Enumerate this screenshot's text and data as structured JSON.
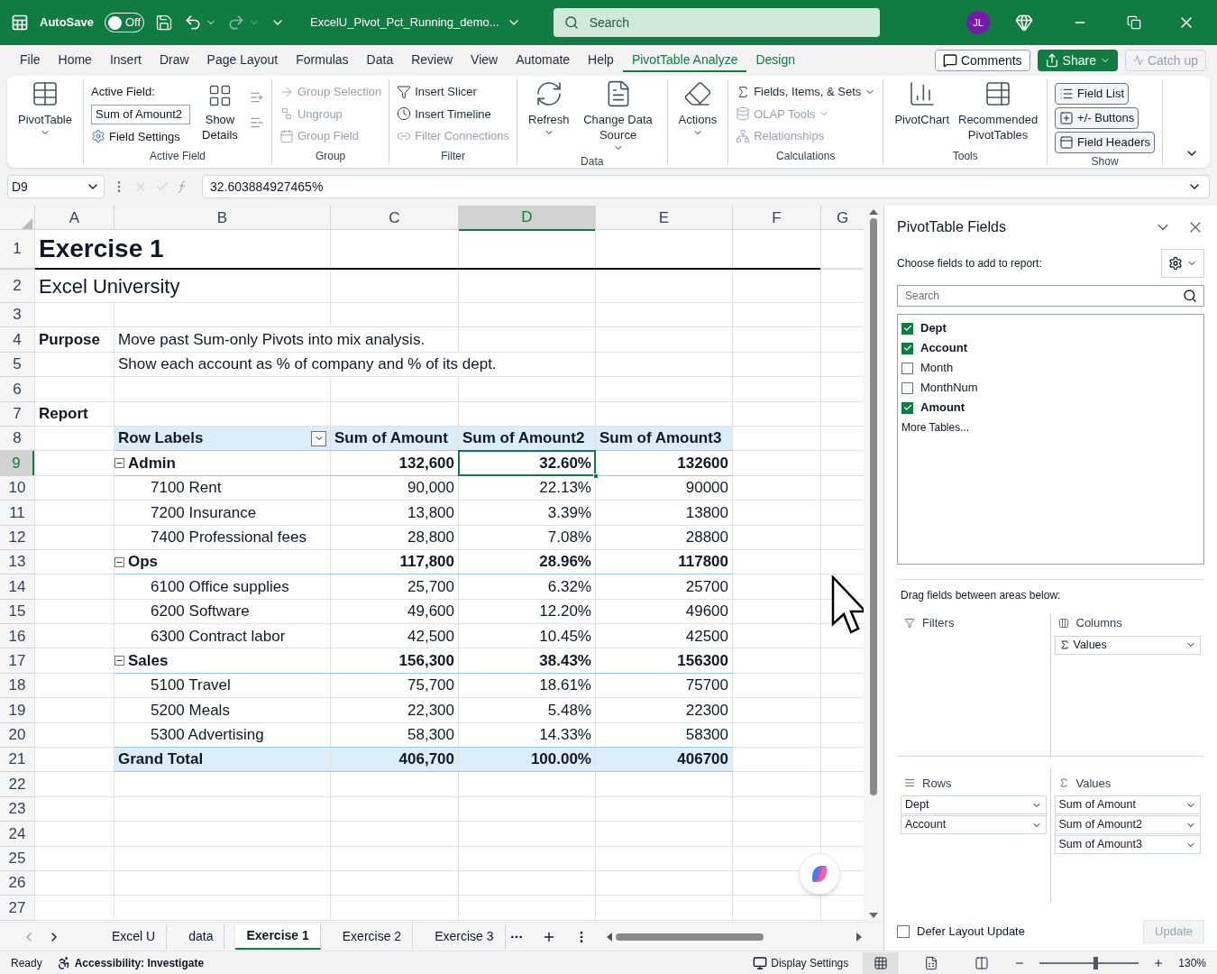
{
  "title_bar": {
    "autosave": {
      "label": "AutoSave",
      "state": "Off",
      "on": false
    },
    "file_name": "ExcelU_Pivot_Pct_Running_demo...",
    "search": {
      "placeholder": "Search"
    },
    "avatar": "JL"
  },
  "menu_tabs": [
    {
      "label": "File",
      "selected": false,
      "kind": "normal"
    },
    {
      "label": "Home",
      "selected": false,
      "kind": "normal"
    },
    {
      "label": "Insert",
      "selected": false,
      "kind": "normal"
    },
    {
      "label": "Draw",
      "selected": false,
      "kind": "normal"
    },
    {
      "label": "Page Layout",
      "selected": false,
      "kind": "normal"
    },
    {
      "label": "Formulas",
      "selected": false,
      "kind": "normal"
    },
    {
      "label": "Data",
      "selected": false,
      "kind": "normal"
    },
    {
      "label": "Review",
      "selected": false,
      "kind": "normal"
    },
    {
      "label": "View",
      "selected": false,
      "kind": "normal"
    },
    {
      "label": "Automate",
      "selected": false,
      "kind": "normal"
    },
    {
      "label": "Help",
      "selected": false,
      "kind": "normal"
    },
    {
      "label": "PivotTable Analyze",
      "selected": true,
      "kind": "contextual"
    },
    {
      "label": "Design",
      "selected": false,
      "kind": "contextual"
    }
  ],
  "menu_actions": {
    "comments": "Comments",
    "share": "Share",
    "catch_up": {
      "label": "Catch up",
      "disabled": true
    }
  },
  "ribbon": {
    "groups": [
      {
        "kind": "large",
        "items": [
          {
            "label": "PivotTable",
            "caret": true,
            "disabled": false
          }
        ]
      },
      {
        "kind": "active_field",
        "label": "Active Field",
        "field_label": "Active Field:",
        "field_value": "Sum of Amount2",
        "settings": "Field Settings",
        "details": "Show Details"
      },
      {
        "kind": "small",
        "label": "Group",
        "items": [
          {
            "label": "Group Selection",
            "caret": false,
            "disabled": true
          },
          {
            "label": "Ungroup",
            "caret": false,
            "disabled": true
          },
          {
            "label": "Group Field",
            "caret": false,
            "disabled": true
          }
        ]
      },
      {
        "kind": "small",
        "label": "Filter",
        "items": [
          {
            "label": "Insert Slicer",
            "caret": false,
            "disabled": false
          },
          {
            "label": "Insert Timeline",
            "caret": false,
            "disabled": false
          },
          {
            "label": "Filter Connections",
            "caret": false,
            "disabled": true
          }
        ]
      },
      {
        "kind": "large",
        "label": "Data",
        "items": [
          {
            "label": "Refresh",
            "caret": true,
            "disabled": false
          },
          {
            "label": "Change Data Source",
            "caret": true,
            "disabled": false
          }
        ]
      },
      {
        "kind": "large",
        "items": [
          {
            "label": "Actions",
            "caret": true,
            "disabled": false
          }
        ]
      },
      {
        "kind": "small",
        "label": "Calculations",
        "items": [
          {
            "label": "Fields, Items, & Sets",
            "caret": true,
            "disabled": false
          },
          {
            "label": "OLAP Tools",
            "caret": true,
            "disabled": true
          },
          {
            "label": "Relationships",
            "caret": false,
            "disabled": true
          }
        ]
      },
      {
        "kind": "large",
        "label": "Tools",
        "items": [
          {
            "label": "PivotChart",
            "caret": false,
            "disabled": false
          },
          {
            "label": "Recommended PivotTables",
            "caret": false,
            "disabled": false
          }
        ]
      },
      {
        "kind": "toggle",
        "label": "Show",
        "items": [
          {
            "label": "Field List",
            "selected": true
          },
          {
            "label": "+/- Buttons",
            "selected": true
          },
          {
            "label": "Field Headers",
            "selected": true
          }
        ]
      }
    ]
  },
  "formula_bar": {
    "name_box": "D9",
    "formula": "32.603884927465%"
  },
  "sheet": {
    "columns": [
      {
        "label": "A",
        "selected": false
      },
      {
        "label": "B",
        "selected": false
      },
      {
        "label": "C",
        "selected": false
      },
      {
        "label": "D",
        "selected": true
      },
      {
        "label": "E",
        "selected": false
      },
      {
        "label": "F",
        "selected": false
      },
      {
        "label": "G",
        "selected": false
      }
    ],
    "rows": [
      {
        "number": "1",
        "selected": false,
        "kind": "title",
        "a": "Exercise 1"
      },
      {
        "number": "2",
        "selected": false,
        "kind": "subtitle",
        "a": "Excel University"
      },
      {
        "number": "3",
        "selected": false,
        "kind": "empty"
      },
      {
        "number": "4",
        "selected": false,
        "kind": "text",
        "a": "Purpose",
        "b": "Move past Sum-only Pivots into mix analysis."
      },
      {
        "number": "5",
        "selected": false,
        "kind": "text",
        "b": "Show each account as % of company and % of its dept."
      },
      {
        "number": "6",
        "selected": false,
        "kind": "empty"
      },
      {
        "number": "7",
        "selected": false,
        "kind": "text",
        "a": "Report"
      },
      {
        "number": "8",
        "selected": false,
        "kind": "pivot_header",
        "label": "Row Labels",
        "values": [
          "Sum of Amount",
          "Sum of Amount2",
          "Sum of Amount3"
        ]
      },
      {
        "number": "9",
        "selected": true,
        "kind": "pivot_group",
        "expanded": true,
        "label": "Admin",
        "values": [
          "132,600",
          "32.60%",
          "132600"
        ]
      },
      {
        "number": "10",
        "selected": false,
        "kind": "pivot_item",
        "label": "7100 Rent",
        "values": [
          "90,000",
          "22.13%",
          "90000"
        ]
      },
      {
        "number": "11",
        "selected": false,
        "kind": "pivot_item",
        "label": "7200 Insurance",
        "values": [
          "13,800",
          "3.39%",
          "13800"
        ]
      },
      {
        "number": "12",
        "selected": false,
        "kind": "pivot_item",
        "label": "7400 Professional fees",
        "values": [
          "28,800",
          "7.08%",
          "28800"
        ]
      },
      {
        "number": "13",
        "selected": false,
        "kind": "pivot_group",
        "expanded": true,
        "label": "Ops",
        "values": [
          "117,800",
          "28.96%",
          "117800"
        ]
      },
      {
        "number": "14",
        "selected": false,
        "kind": "pivot_item",
        "label": "6100 Office supplies",
        "values": [
          "25,700",
          "6.32%",
          "25700"
        ]
      },
      {
        "number": "15",
        "selected": false,
        "kind": "pivot_item",
        "label": "6200 Software",
        "values": [
          "49,600",
          "12.20%",
          "49600"
        ]
      },
      {
        "number": "16",
        "selected": false,
        "kind": "pivot_item",
        "label": "6300 Contract labor",
        "values": [
          "42,500",
          "10.45%",
          "42500"
        ]
      },
      {
        "number": "17",
        "selected": false,
        "kind": "pivot_group",
        "expanded": true,
        "label": "Sales",
        "values": [
          "156,300",
          "38.43%",
          "156300"
        ]
      },
      {
        "number": "18",
        "selected": false,
        "kind": "pivot_item",
        "label": "5100 Travel",
        "values": [
          "75,700",
          "18.61%",
          "75700"
        ]
      },
      {
        "number": "19",
        "selected": false,
        "kind": "pivot_item",
        "label": "5200 Meals",
        "values": [
          "22,300",
          "5.48%",
          "22300"
        ]
      },
      {
        "number": "20",
        "selected": false,
        "kind": "pivot_item",
        "label": "5300 Advertising",
        "values": [
          "58,300",
          "14.33%",
          "58300"
        ]
      },
      {
        "number": "21",
        "selected": false,
        "kind": "pivot_total",
        "label": "Grand Total",
        "values": [
          "406,700",
          "100.00%",
          "406700"
        ]
      },
      {
        "number": "22",
        "selected": false,
        "kind": "empty"
      },
      {
        "number": "23",
        "selected": false,
        "kind": "empty"
      },
      {
        "number": "24",
        "selected": false,
        "kind": "empty"
      },
      {
        "number": "25",
        "selected": false,
        "kind": "empty"
      },
      {
        "number": "26",
        "selected": false,
        "kind": "empty"
      },
      {
        "number": "27",
        "selected": false,
        "kind": "empty"
      }
    ]
  },
  "sheet_tabs": [
    {
      "label": "Excel U",
      "selected": false
    },
    {
      "label": "data",
      "selected": false
    },
    {
      "label": "Exercise 1",
      "selected": true
    },
    {
      "label": "Exercise 2",
      "selected": false
    },
    {
      "label": "Exercise 3",
      "selected": false
    }
  ],
  "pivot_fields": {
    "title": "PivotTable Fields",
    "prompt": "Choose fields to add to report:",
    "search": {
      "placeholder": "Search"
    },
    "fields": [
      {
        "label": "Dept",
        "checked": true
      },
      {
        "label": "Account",
        "checked": true
      },
      {
        "label": "Month",
        "checked": false
      },
      {
        "label": "MonthNum",
        "checked": false
      },
      {
        "label": "Amount",
        "checked": true
      }
    ],
    "more_tables": "More Tables...",
    "drag_hint": "Drag fields between areas below:",
    "areas": [
      {
        "kind": "filters",
        "label": "Filters"
      },
      {
        "kind": "columns",
        "label": "Columns",
        "items": [
          {
            "label": "Values",
            "kind": "values"
          }
        ]
      },
      {
        "kind": "rows",
        "label": "Rows",
        "items": [
          {
            "label": "Dept",
            "kind": "field"
          },
          {
            "label": "Account",
            "kind": "field"
          }
        ]
      },
      {
        "kind": "values",
        "label": "Values",
        "items": [
          {
            "label": "Sum of Amount",
            "kind": "field"
          },
          {
            "label": "Sum of Amount2",
            "kind": "field"
          },
          {
            "label": "Sum of Amount3",
            "kind": "field"
          }
        ]
      }
    ],
    "defer": {
      "label": "Defer Layout Update",
      "checked": false
    },
    "update": {
      "label": "Update",
      "disabled": true
    }
  },
  "status_bar": {
    "ready": "Ready",
    "accessibility": "Accessibility: Investigate",
    "display_settings": "Display Settings",
    "views": [
      {
        "kind": "normal",
        "selected": true
      },
      {
        "kind": "page_layout",
        "selected": false
      },
      {
        "kind": "page_break",
        "selected": false
      }
    ],
    "zoom": {
      "level": 0.57,
      "label": "130%"
    }
  }
}
